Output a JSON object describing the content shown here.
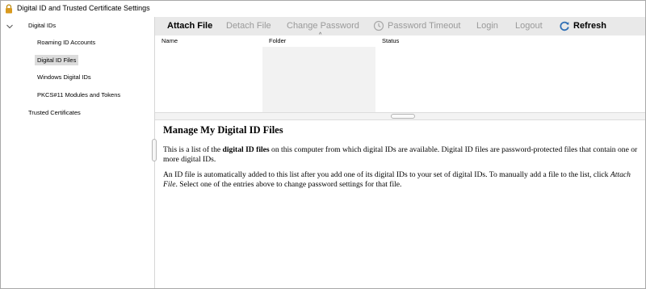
{
  "window": {
    "title": "Digital ID and Trusted Certificate Settings"
  },
  "sidebar": {
    "items": [
      {
        "label": "Digital IDs"
      },
      {
        "label": "Roaming ID Accounts"
      },
      {
        "label": "Digital ID Files"
      },
      {
        "label": "Windows Digital IDs"
      },
      {
        "label": "PKCS#11 Modules and Tokens"
      },
      {
        "label": "Trusted Certificates"
      }
    ],
    "selected": "Digital ID Files"
  },
  "toolbar": {
    "attach_file": "Attach File",
    "detach_file": "Detach File",
    "change_password": "Change Password",
    "password_timeout": "Password Timeout",
    "login": "Login",
    "logout": "Logout",
    "refresh": "Refresh"
  },
  "table": {
    "columns": [
      "Name",
      "Folder",
      "Status"
    ],
    "rows": []
  },
  "content": {
    "heading": "Manage My Digital ID Files",
    "p1_before": "This is a list of the ",
    "p1_bold": "digital ID files",
    "p1_after": " on this computer from which digital IDs are available. Digital ID files are password-protected files that contain one or more digital IDs.",
    "p2_before": "An ID file is automatically added to this list after you add one of its digital IDs to your set of digital IDs. To manually add a file to the list, click ",
    "p2_italic": "Attach File",
    "p2_after": ". Select one of the entries above to change password settings for that file."
  },
  "colors": {
    "toolbar_bg": "#e9e9e9",
    "selected_bg": "#dcdcdc",
    "disabled_text": "#9a9a9a",
    "refresh_icon": "#2f6fb5"
  }
}
